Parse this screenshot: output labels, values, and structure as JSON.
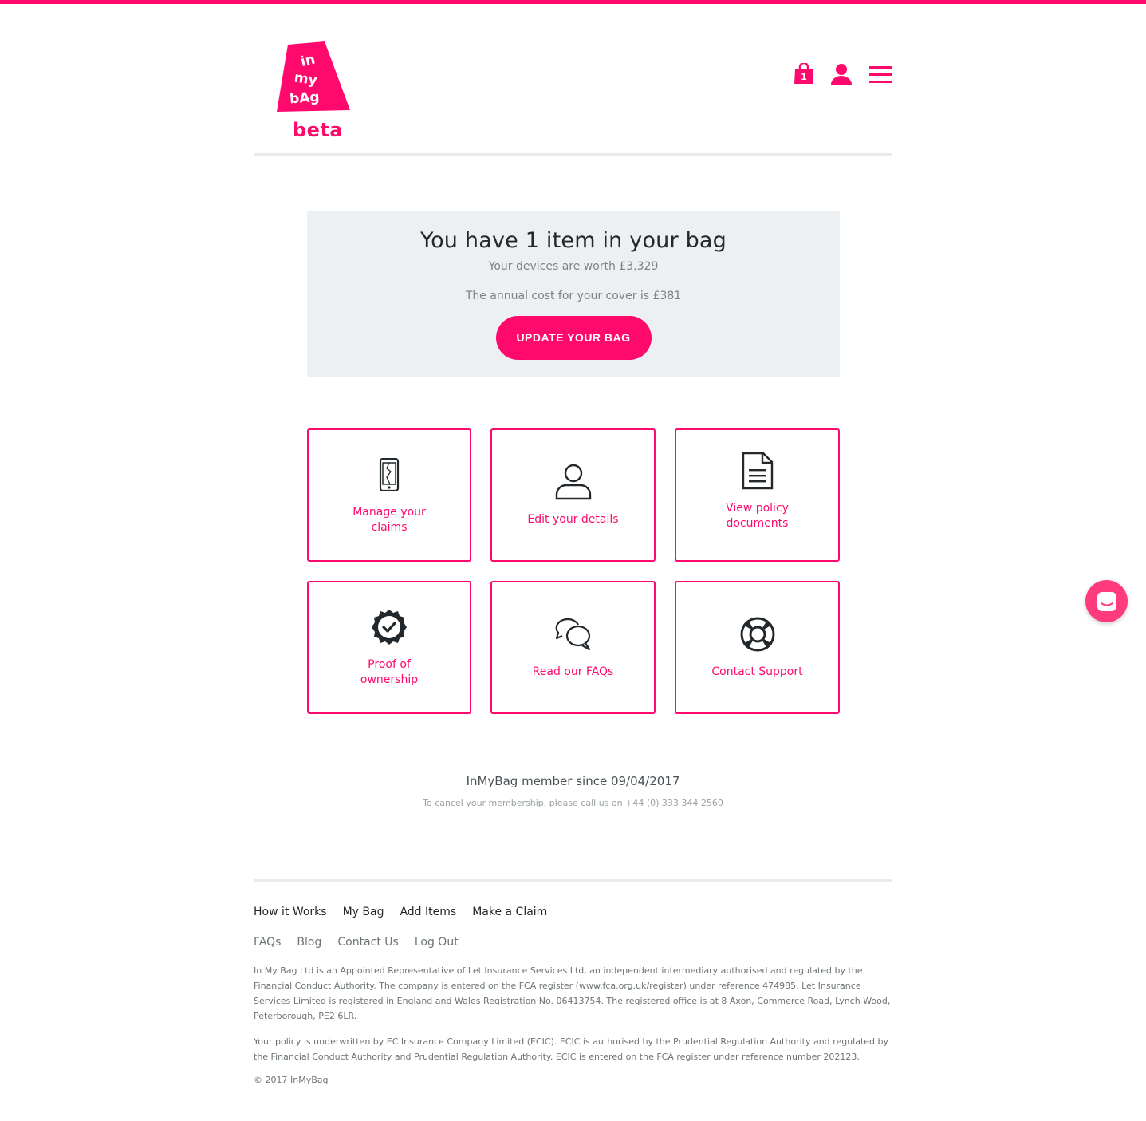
{
  "brand": {
    "logo_text": "in my bAg",
    "beta_label": "beta",
    "accent_color": "#ff0a6c"
  },
  "header": {
    "bag_count": "1",
    "icons": [
      "shopping-bag-icon",
      "user-icon",
      "hamburger-menu-icon"
    ]
  },
  "summary": {
    "title": "You have 1 item in your bag",
    "worth": "Your devices are worth £3,329",
    "annual_cost": "The annual cost for your cover is £381",
    "update_button": "UPDATE YOUR BAG"
  },
  "tiles": [
    {
      "label": "Manage your claims",
      "icon": "cracked-phone-icon"
    },
    {
      "label": "Edit your details",
      "icon": "person-outline-icon"
    },
    {
      "label": "View policy documents",
      "icon": "document-icon"
    },
    {
      "label": "Proof of ownership",
      "icon": "verified-badge-icon"
    },
    {
      "label": "Read our FAQs",
      "icon": "chat-bubbles-icon"
    },
    {
      "label": "Contact Support",
      "icon": "lifebuoy-icon"
    }
  ],
  "membership": {
    "since": "InMyBag member since 09/04/2017",
    "cancel_note": "To cancel your membership, please call us on +44 (0) 333 344 2560"
  },
  "footer": {
    "primary_links": [
      "How it Works",
      "My Bag",
      "Add Items",
      "Make a Claim"
    ],
    "secondary_links": [
      "FAQs",
      "Blog",
      "Contact Us",
      "Log Out"
    ],
    "legal_1": "In My Bag Ltd is an Appointed Representative of Let Insurance Services Ltd, an independent intermediary authorised and regulated by the Financial Conduct Authority. The company is entered on the FCA register (www.fca.org.uk/register) under reference 474985. Let Insurance Services Limited is registered in England and Wales Registration No. 06413754. The registered office is at 8 Axon, Commerce Road, Lynch Wood, Peterborough, PE2 6LR.",
    "legal_2": "Your policy is underwritten by EC Insurance Company Limited (ECIC). ECIC is authorised by the Prudential Regulation Authority and regulated by the Financial Conduct Authority and Prudential Regulation Authority. ECIC is entered on the FCA register under reference number 202123.",
    "copyright": "© 2017 InMyBag"
  },
  "chat_widget": {
    "icon": "chat-launcher-icon"
  }
}
